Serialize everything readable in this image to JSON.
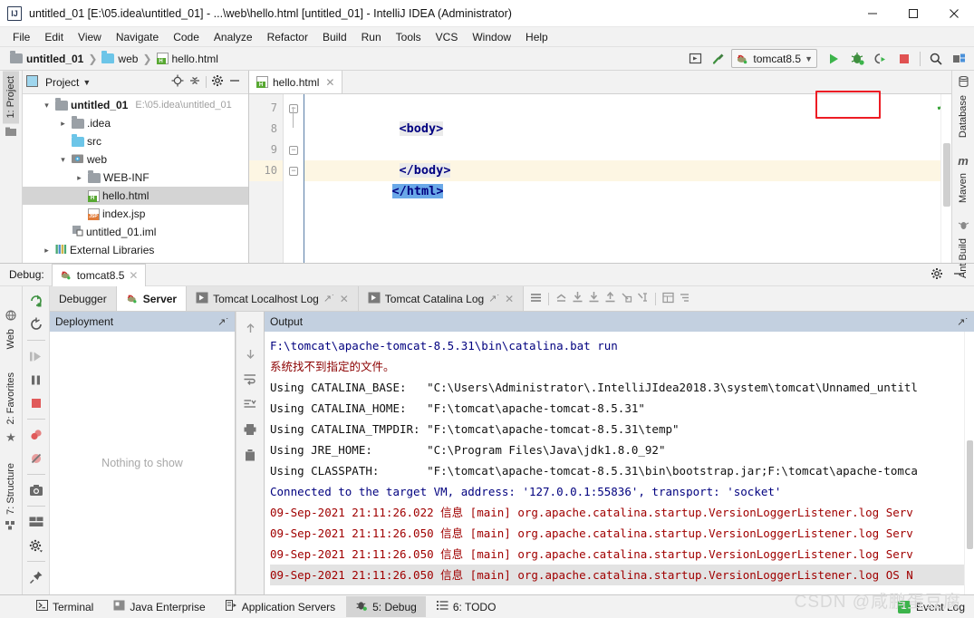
{
  "window": {
    "title": "untitled_01 [E:\\05.idea\\untitled_01] - ...\\web\\hello.html [untitled_01] - IntelliJ IDEA (Administrator)",
    "app_icon": "IJ",
    "minimize": "minimize-icon",
    "maximize": "maximize-icon",
    "close": "close-icon"
  },
  "menu": {
    "items": [
      "File",
      "Edit",
      "View",
      "Navigate",
      "Code",
      "Analyze",
      "Refactor",
      "Build",
      "Run",
      "Tools",
      "VCS",
      "Window",
      "Help"
    ]
  },
  "navbar": {
    "breadcrumb": [
      "untitled_01",
      "web",
      "hello.html"
    ],
    "run_config": "tomcat8.5",
    "buttons": {
      "select_opened_file": "select-opened-file-icon",
      "build": "build-hammer-icon",
      "run": "run-icon",
      "debug": "debug-icon",
      "attach": "attach-profiler-icon",
      "stop": "stop-icon",
      "search": "search-everywhere-icon",
      "project_structure": "project-structure-icon"
    },
    "highlight_color": "#ed1c24"
  },
  "left_stripe": {
    "top": [
      "1: Project"
    ],
    "bottom": [
      "Web",
      "2: Favorites",
      "7: Structure"
    ]
  },
  "right_stripe": {
    "items": [
      "Database",
      "Maven",
      "Ant Build"
    ]
  },
  "project_panel": {
    "title": "Project",
    "tools": [
      "locate-icon",
      "collapse-all-icon",
      "settings-gear-icon",
      "hide-icon"
    ],
    "tree": [
      {
        "indent": 0,
        "arrow": "v",
        "icon": "module-folder",
        "label": "untitled_01",
        "bold": true,
        "sub": "E:\\05.idea\\untitled_01",
        "selected": false
      },
      {
        "indent": 1,
        "arrow": ">",
        "icon": "folder",
        "label": ".idea",
        "bold": false,
        "sub": "",
        "selected": false
      },
      {
        "indent": 1,
        "arrow": "",
        "icon": "source-folder",
        "label": "src",
        "bold": false,
        "sub": "",
        "selected": false
      },
      {
        "indent": 1,
        "arrow": "v",
        "icon": "web-folder",
        "label": "web",
        "bold": false,
        "sub": "",
        "selected": false
      },
      {
        "indent": 2,
        "arrow": ">",
        "icon": "folder",
        "label": "WEB-INF",
        "bold": false,
        "sub": "",
        "selected": false
      },
      {
        "indent": 2,
        "arrow": "",
        "icon": "html-file",
        "label": "hello.html",
        "bold": false,
        "sub": "",
        "selected": true
      },
      {
        "indent": 2,
        "arrow": "",
        "icon": "jsp-file",
        "label": "index.jsp",
        "bold": false,
        "sub": "",
        "selected": false
      },
      {
        "indent": 1,
        "arrow": "",
        "icon": "iml-file",
        "label": "untitled_01.iml",
        "bold": false,
        "sub": "",
        "selected": false
      },
      {
        "indent": 0,
        "arrow": ">",
        "icon": "libraries",
        "label": "External Libraries",
        "bold": false,
        "sub": "",
        "selected": false
      }
    ]
  },
  "editor": {
    "tab": {
      "label": "hello.html",
      "icon": "html-file",
      "close": "close-tab-icon"
    },
    "lines": [
      {
        "number": "7",
        "text": "<body>",
        "current": false,
        "fold": true,
        "selected": false
      },
      {
        "number": "8",
        "text": "",
        "current": false,
        "fold": false,
        "selected": false
      },
      {
        "number": "9",
        "text": "</body>",
        "current": false,
        "fold": true,
        "selected": false
      },
      {
        "number": "10",
        "text": "</html>",
        "current": true,
        "fold": true,
        "selected": true
      }
    ],
    "inspection_status": "ok-check-icon"
  },
  "debug": {
    "header_label": "Debug:",
    "run_tab": "tomcat8.5",
    "header_tools": [
      "settings-gear-icon",
      "hide-panel-icon"
    ],
    "left_tools": [
      "resume-program-icon",
      "pause-program-icon",
      "stop-icon",
      "view-breakpoints-icon",
      "mute-breakpoints-icon",
      "get-thread-dump-icon",
      "restore-layout-icon",
      "settings-gear-icon",
      "pin-tab-icon"
    ],
    "rerun_icons": [
      "rerun-icon",
      "update-application-icon"
    ],
    "tabs": [
      {
        "label": "Debugger",
        "icon": "",
        "active": false,
        "pin": false,
        "close": false
      },
      {
        "label": "Server",
        "icon": "tomcat-icon",
        "active": true,
        "pin": false,
        "close": false
      },
      {
        "label": "Tomcat Localhost Log",
        "icon": "console-icon",
        "active": false,
        "pin": true,
        "close": true
      },
      {
        "label": "Tomcat Catalina Log",
        "icon": "console-icon",
        "active": false,
        "pin": true,
        "close": true
      }
    ],
    "tab_tools": [
      "layout-settings-icon",
      "scroll-up-icon",
      "step-over-icon",
      "step-into-icon",
      "step-out-icon",
      "run-to-cursor-icon",
      "force-step-icon",
      "evaluate-expression-icon",
      "console-filter-icon"
    ],
    "tab_tools_right": [
      "align-icon",
      "split-icon",
      "gauge-icon"
    ],
    "deployment": {
      "title": "Deployment",
      "pin": "pin-icon",
      "empty_text": "Nothing to show",
      "tools": [
        "up-arrow-icon",
        "down-arrow-icon",
        "soft-wrap-icon",
        "scroll-to-end-icon",
        "print-icon",
        "delete-icon"
      ]
    },
    "output": {
      "title": "Output",
      "pin": "pin-icon",
      "lines": [
        {
          "text": "F:\\tomcat\\apache-tomcat-8.5.31\\bin\\catalina.bat run",
          "color": "blue",
          "highlight": false
        },
        {
          "text": "系统找不到指定的文件。",
          "color": "dkred",
          "highlight": false
        },
        {
          "text": "Using CATALINA_BASE:   \"C:\\Users\\Administrator\\.IntelliJIdea2018.3\\system\\tomcat\\Unnamed_untitl",
          "color": "black",
          "highlight": false
        },
        {
          "text": "Using CATALINA_HOME:   \"F:\\tomcat\\apache-tomcat-8.5.31\"",
          "color": "black",
          "highlight": false
        },
        {
          "text": "Using CATALINA_TMPDIR: \"F:\\tomcat\\apache-tomcat-8.5.31\\temp\"",
          "color": "black",
          "highlight": false
        },
        {
          "text": "Using JRE_HOME:        \"C:\\Program Files\\Java\\jdk1.8.0_92\"",
          "color": "black",
          "highlight": false
        },
        {
          "text": "Using CLASSPATH:       \"F:\\tomcat\\apache-tomcat-8.5.31\\bin\\bootstrap.jar;F:\\tomcat\\apache-tomca",
          "color": "black",
          "highlight": false
        },
        {
          "text": "Connected to the target VM, address: '127.0.0.1:55836', transport: 'socket'",
          "color": "blue",
          "highlight": false
        },
        {
          "text": "09-Sep-2021 21:11:26.022 信息 [main] org.apache.catalina.startup.VersionLoggerListener.log Serv",
          "color": "red",
          "highlight": false
        },
        {
          "text": "09-Sep-2021 21:11:26.050 信息 [main] org.apache.catalina.startup.VersionLoggerListener.log Serv",
          "color": "red",
          "highlight": false
        },
        {
          "text": "09-Sep-2021 21:11:26.050 信息 [main] org.apache.catalina.startup.VersionLoggerListener.log Serv",
          "color": "red",
          "highlight": false
        },
        {
          "text": "09-Sep-2021 21:11:26.050 信息 [main] org.apache.catalina.startup.VersionLoggerListener.log OS N",
          "color": "red",
          "highlight": true
        }
      ]
    }
  },
  "statusbar": {
    "buttons": [
      {
        "label": "Terminal",
        "icon": "terminal-icon",
        "active": false,
        "mnemonic": ""
      },
      {
        "label": "Java Enterprise",
        "icon": "java-enterprise-icon",
        "active": false,
        "mnemonic": ""
      },
      {
        "label": "Application Servers",
        "icon": "app-servers-icon",
        "active": false,
        "mnemonic": ""
      },
      {
        "label": "5: Debug",
        "icon": "debug-bug-icon",
        "active": true,
        "mnemonic": "5"
      },
      {
        "label": "6: TODO",
        "icon": "todo-icon",
        "active": false,
        "mnemonic": "6"
      }
    ],
    "event_log": {
      "label": "Event Log",
      "badge": "1"
    }
  },
  "watermark": "CSDN @咸鹏蛋豆腐"
}
